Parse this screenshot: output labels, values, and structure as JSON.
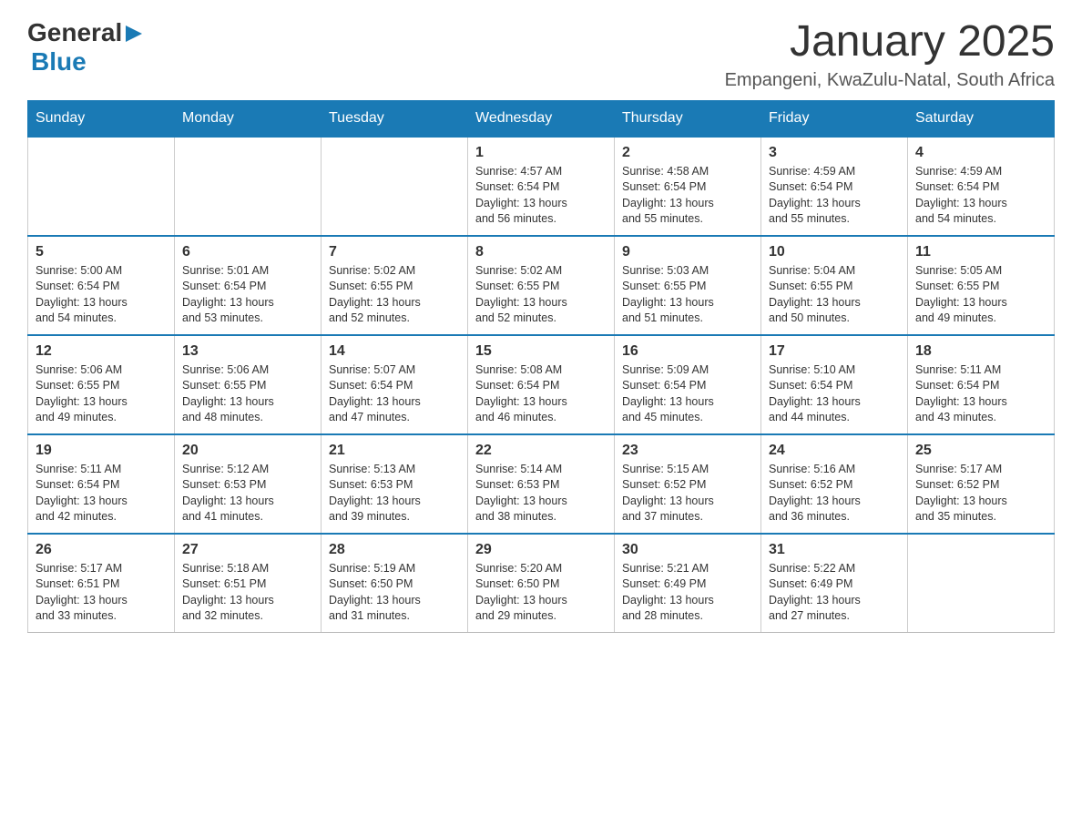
{
  "header": {
    "logo_general": "General",
    "logo_blue": "Blue",
    "month_title": "January 2025",
    "location": "Empangeni, KwaZulu-Natal, South Africa"
  },
  "days_of_week": [
    "Sunday",
    "Monday",
    "Tuesday",
    "Wednesday",
    "Thursday",
    "Friday",
    "Saturday"
  ],
  "weeks": [
    [
      {
        "day": "",
        "info": ""
      },
      {
        "day": "",
        "info": ""
      },
      {
        "day": "",
        "info": ""
      },
      {
        "day": "1",
        "info": "Sunrise: 4:57 AM\nSunset: 6:54 PM\nDaylight: 13 hours\nand 56 minutes."
      },
      {
        "day": "2",
        "info": "Sunrise: 4:58 AM\nSunset: 6:54 PM\nDaylight: 13 hours\nand 55 minutes."
      },
      {
        "day": "3",
        "info": "Sunrise: 4:59 AM\nSunset: 6:54 PM\nDaylight: 13 hours\nand 55 minutes."
      },
      {
        "day": "4",
        "info": "Sunrise: 4:59 AM\nSunset: 6:54 PM\nDaylight: 13 hours\nand 54 minutes."
      }
    ],
    [
      {
        "day": "5",
        "info": "Sunrise: 5:00 AM\nSunset: 6:54 PM\nDaylight: 13 hours\nand 54 minutes."
      },
      {
        "day": "6",
        "info": "Sunrise: 5:01 AM\nSunset: 6:54 PM\nDaylight: 13 hours\nand 53 minutes."
      },
      {
        "day": "7",
        "info": "Sunrise: 5:02 AM\nSunset: 6:55 PM\nDaylight: 13 hours\nand 52 minutes."
      },
      {
        "day": "8",
        "info": "Sunrise: 5:02 AM\nSunset: 6:55 PM\nDaylight: 13 hours\nand 52 minutes."
      },
      {
        "day": "9",
        "info": "Sunrise: 5:03 AM\nSunset: 6:55 PM\nDaylight: 13 hours\nand 51 minutes."
      },
      {
        "day": "10",
        "info": "Sunrise: 5:04 AM\nSunset: 6:55 PM\nDaylight: 13 hours\nand 50 minutes."
      },
      {
        "day": "11",
        "info": "Sunrise: 5:05 AM\nSunset: 6:55 PM\nDaylight: 13 hours\nand 49 minutes."
      }
    ],
    [
      {
        "day": "12",
        "info": "Sunrise: 5:06 AM\nSunset: 6:55 PM\nDaylight: 13 hours\nand 49 minutes."
      },
      {
        "day": "13",
        "info": "Sunrise: 5:06 AM\nSunset: 6:55 PM\nDaylight: 13 hours\nand 48 minutes."
      },
      {
        "day": "14",
        "info": "Sunrise: 5:07 AM\nSunset: 6:54 PM\nDaylight: 13 hours\nand 47 minutes."
      },
      {
        "day": "15",
        "info": "Sunrise: 5:08 AM\nSunset: 6:54 PM\nDaylight: 13 hours\nand 46 minutes."
      },
      {
        "day": "16",
        "info": "Sunrise: 5:09 AM\nSunset: 6:54 PM\nDaylight: 13 hours\nand 45 minutes."
      },
      {
        "day": "17",
        "info": "Sunrise: 5:10 AM\nSunset: 6:54 PM\nDaylight: 13 hours\nand 44 minutes."
      },
      {
        "day": "18",
        "info": "Sunrise: 5:11 AM\nSunset: 6:54 PM\nDaylight: 13 hours\nand 43 minutes."
      }
    ],
    [
      {
        "day": "19",
        "info": "Sunrise: 5:11 AM\nSunset: 6:54 PM\nDaylight: 13 hours\nand 42 minutes."
      },
      {
        "day": "20",
        "info": "Sunrise: 5:12 AM\nSunset: 6:53 PM\nDaylight: 13 hours\nand 41 minutes."
      },
      {
        "day": "21",
        "info": "Sunrise: 5:13 AM\nSunset: 6:53 PM\nDaylight: 13 hours\nand 39 minutes."
      },
      {
        "day": "22",
        "info": "Sunrise: 5:14 AM\nSunset: 6:53 PM\nDaylight: 13 hours\nand 38 minutes."
      },
      {
        "day": "23",
        "info": "Sunrise: 5:15 AM\nSunset: 6:52 PM\nDaylight: 13 hours\nand 37 minutes."
      },
      {
        "day": "24",
        "info": "Sunrise: 5:16 AM\nSunset: 6:52 PM\nDaylight: 13 hours\nand 36 minutes."
      },
      {
        "day": "25",
        "info": "Sunrise: 5:17 AM\nSunset: 6:52 PM\nDaylight: 13 hours\nand 35 minutes."
      }
    ],
    [
      {
        "day": "26",
        "info": "Sunrise: 5:17 AM\nSunset: 6:51 PM\nDaylight: 13 hours\nand 33 minutes."
      },
      {
        "day": "27",
        "info": "Sunrise: 5:18 AM\nSunset: 6:51 PM\nDaylight: 13 hours\nand 32 minutes."
      },
      {
        "day": "28",
        "info": "Sunrise: 5:19 AM\nSunset: 6:50 PM\nDaylight: 13 hours\nand 31 minutes."
      },
      {
        "day": "29",
        "info": "Sunrise: 5:20 AM\nSunset: 6:50 PM\nDaylight: 13 hours\nand 29 minutes."
      },
      {
        "day": "30",
        "info": "Sunrise: 5:21 AM\nSunset: 6:49 PM\nDaylight: 13 hours\nand 28 minutes."
      },
      {
        "day": "31",
        "info": "Sunrise: 5:22 AM\nSunset: 6:49 PM\nDaylight: 13 hours\nand 27 minutes."
      },
      {
        "day": "",
        "info": ""
      }
    ]
  ]
}
